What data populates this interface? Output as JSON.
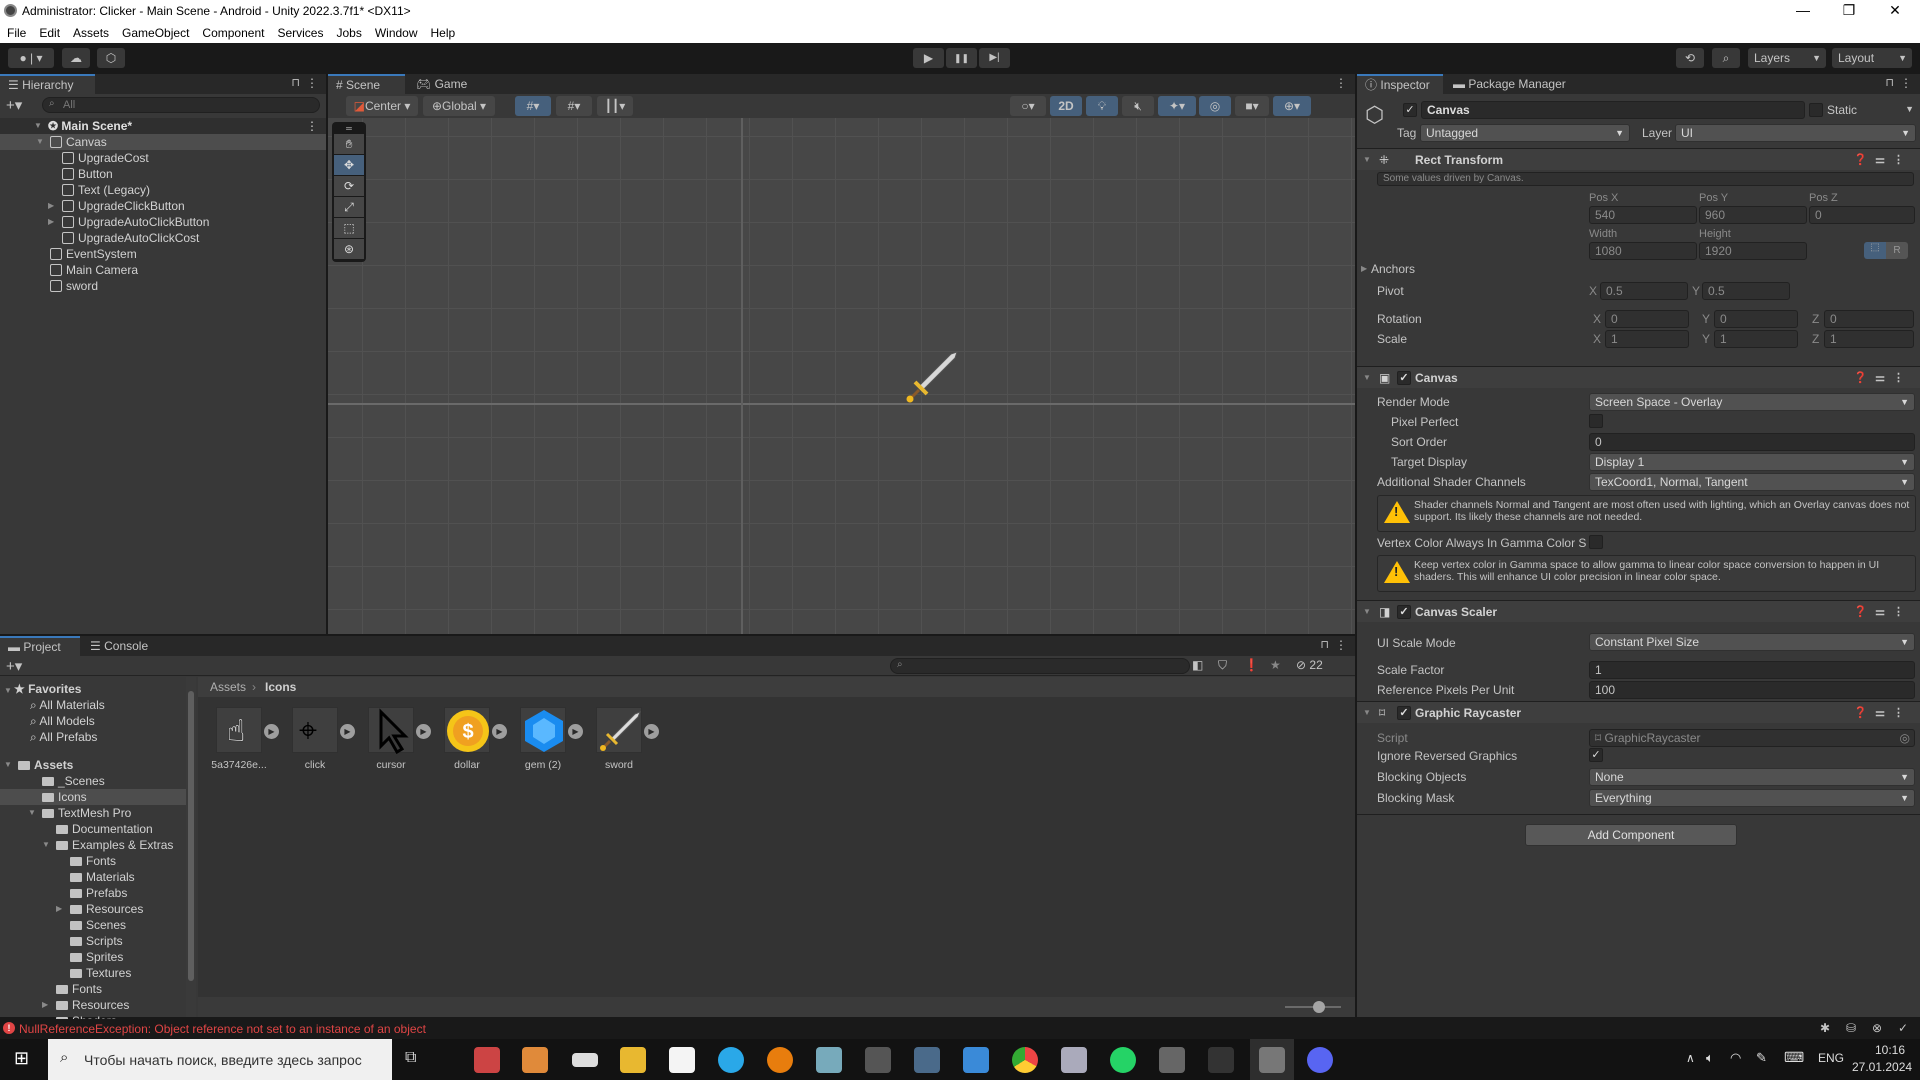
{
  "window": {
    "title": "Administrator: Clicker - Main Scene - Android - Unity 2022.3.7f1* <DX11>",
    "minimize": "—",
    "maximize": "❐",
    "close": "✕"
  },
  "menu": [
    "File",
    "Edit",
    "Assets",
    "GameObject",
    "Component",
    "Services",
    "Jobs",
    "Window",
    "Help"
  ],
  "toolbar": {
    "layers": "Layers",
    "layout": "Layout",
    "play_icon": "▶",
    "pause_icon": "❚❚",
    "step_icon": "▶|"
  },
  "hierarchy": {
    "tab": "Hierarchy",
    "search_placeholder": "All",
    "scene": "Main Scene*",
    "items": [
      {
        "label": "Canvas",
        "depth": 1,
        "expand": "open",
        "selected": true
      },
      {
        "label": "UpgradeCost",
        "depth": 2,
        "expand": ""
      },
      {
        "label": "Button",
        "depth": 2,
        "expand": ""
      },
      {
        "label": "Text (Legacy)",
        "depth": 2,
        "expand": ""
      },
      {
        "label": "UpgradeClickButton",
        "depth": 2,
        "expand": "closed"
      },
      {
        "label": "UpgradeAutoClickButton",
        "depth": 2,
        "expand": "closed"
      },
      {
        "label": "UpgradeAutoClickCost",
        "depth": 2,
        "expand": ""
      },
      {
        "label": "EventSystem",
        "depth": 1,
        "expand": ""
      },
      {
        "label": "Main Camera",
        "depth": 1,
        "expand": ""
      },
      {
        "label": "sword",
        "depth": 1,
        "expand": ""
      }
    ]
  },
  "scene": {
    "tabs": [
      "Scene",
      "Game"
    ],
    "pivot": "Center",
    "space": "Global",
    "mode_2d": "2D"
  },
  "inspector": {
    "tabs": [
      "Inspector",
      "Package Manager"
    ],
    "object_name": "Canvas",
    "active": true,
    "static_label": "Static",
    "tag_label": "Tag",
    "tag": "Untagged",
    "layer_label": "Layer",
    "layer": "UI",
    "rect_transform": {
      "title": "Rect Transform",
      "note": "Some values driven by Canvas.",
      "pos_x_label": "Pos X",
      "pos_y_label": "Pos Y",
      "pos_z_label": "Pos Z",
      "pos_x": "540",
      "pos_y": "960",
      "pos_z": "0",
      "width_label": "Width",
      "height_label": "Height",
      "width": "1080",
      "height": "1920",
      "anchors": "Anchors",
      "pivot_label": "Pivot",
      "pivot_x": "0.5",
      "pivot_y": "0.5",
      "rotation_label": "Rotation",
      "rot_x": "0",
      "rot_y": "0",
      "rot_z": "0",
      "scale_label": "Scale",
      "scale_x": "1",
      "scale_y": "1",
      "scale_z": "1",
      "r_button": "R"
    },
    "canvas": {
      "title": "Canvas",
      "render_mode_label": "Render Mode",
      "render_mode": "Screen Space - Overlay",
      "pixel_perfect_label": "Pixel Perfect",
      "sort_order_label": "Sort Order",
      "sort_order": "0",
      "target_display_label": "Target Display",
      "target_display": "Display 1",
      "shader_channels_label": "Additional Shader Channels",
      "shader_channels": "TexCoord1, Normal, Tangent",
      "warning1": "Shader channels Normal and Tangent are most often used with lighting, which an Overlay canvas does not support. Its likely these channels are not needed.",
      "vertex_color_label": "Vertex Color Always In Gamma Color S",
      "warning2": "Keep vertex color in Gamma space to allow gamma to linear color space conversion to happen in UI shaders. This will enhance UI color precision in linear color space."
    },
    "canvas_scaler": {
      "title": "Canvas Scaler",
      "ui_scale_mode_label": "UI Scale Mode",
      "ui_scale_mode": "Constant Pixel Size",
      "scale_factor_label": "Scale Factor",
      "scale_factor": "1",
      "ref_ppu_label": "Reference Pixels Per Unit",
      "ref_ppu": "100"
    },
    "graphic_raycaster": {
      "title": "Graphic Raycaster",
      "script_label": "Script",
      "script": "GraphicRaycaster",
      "ignore_reversed_label": "Ignore Reversed Graphics",
      "ignore_reversed": true,
      "blocking_objects_label": "Blocking Objects",
      "blocking_objects": "None",
      "blocking_mask_label": "Blocking Mask",
      "blocking_mask": "Everything"
    },
    "add_component": "Add Component"
  },
  "project": {
    "tabs": [
      "Project",
      "Console"
    ],
    "favorites": {
      "label": "Favorites",
      "items": [
        "All Materials",
        "All Models",
        "All Prefabs"
      ]
    },
    "tree": [
      {
        "label": "Assets",
        "depth": 0,
        "expand": "open",
        "bold": true
      },
      {
        "label": "_Scenes",
        "depth": 1,
        "expand": ""
      },
      {
        "label": "Icons",
        "depth": 1,
        "expand": "",
        "selected": true
      },
      {
        "label": "TextMesh Pro",
        "depth": 1,
        "expand": "open"
      },
      {
        "label": "Documentation",
        "depth": 2,
        "expand": ""
      },
      {
        "label": "Examples & Extras",
        "depth": 2,
        "expand": "open"
      },
      {
        "label": "Fonts",
        "depth": 3,
        "expand": ""
      },
      {
        "label": "Materials",
        "depth": 3,
        "expand": ""
      },
      {
        "label": "Prefabs",
        "depth": 3,
        "expand": ""
      },
      {
        "label": "Resources",
        "depth": 3,
        "expand": "closed"
      },
      {
        "label": "Scenes",
        "depth": 3,
        "expand": ""
      },
      {
        "label": "Scripts",
        "depth": 3,
        "expand": ""
      },
      {
        "label": "Sprites",
        "depth": 3,
        "expand": ""
      },
      {
        "label": "Textures",
        "depth": 3,
        "expand": ""
      },
      {
        "label": "Fonts",
        "depth": 2,
        "expand": ""
      },
      {
        "label": "Resources",
        "depth": 2,
        "expand": "closed"
      },
      {
        "label": "Shaders",
        "depth": 2,
        "expand": ""
      }
    ],
    "breadcrumb": [
      "Assets",
      "Icons"
    ],
    "hidden_count": "22",
    "assets": [
      {
        "name": "5a37426e...",
        "icon": "hand-pointer-icon"
      },
      {
        "name": "click",
        "icon": "click-cursor-icon"
      },
      {
        "name": "cursor",
        "icon": "cursor-arrow-icon"
      },
      {
        "name": "dollar",
        "icon": "gold-coin-icon"
      },
      {
        "name": "gem (2)",
        "icon": "blue-gem-icon"
      },
      {
        "name": "sword",
        "icon": "sword-icon"
      }
    ],
    "zoom_slider": 0.6
  },
  "status": {
    "error": "NullReferenceException: Object reference not set to an instance of an object"
  },
  "taskbar": {
    "search_placeholder": "Чтобы начать поиск, введите здесь запрос",
    "lang": "ENG",
    "time": "10:16",
    "date": "27.01.2024"
  }
}
